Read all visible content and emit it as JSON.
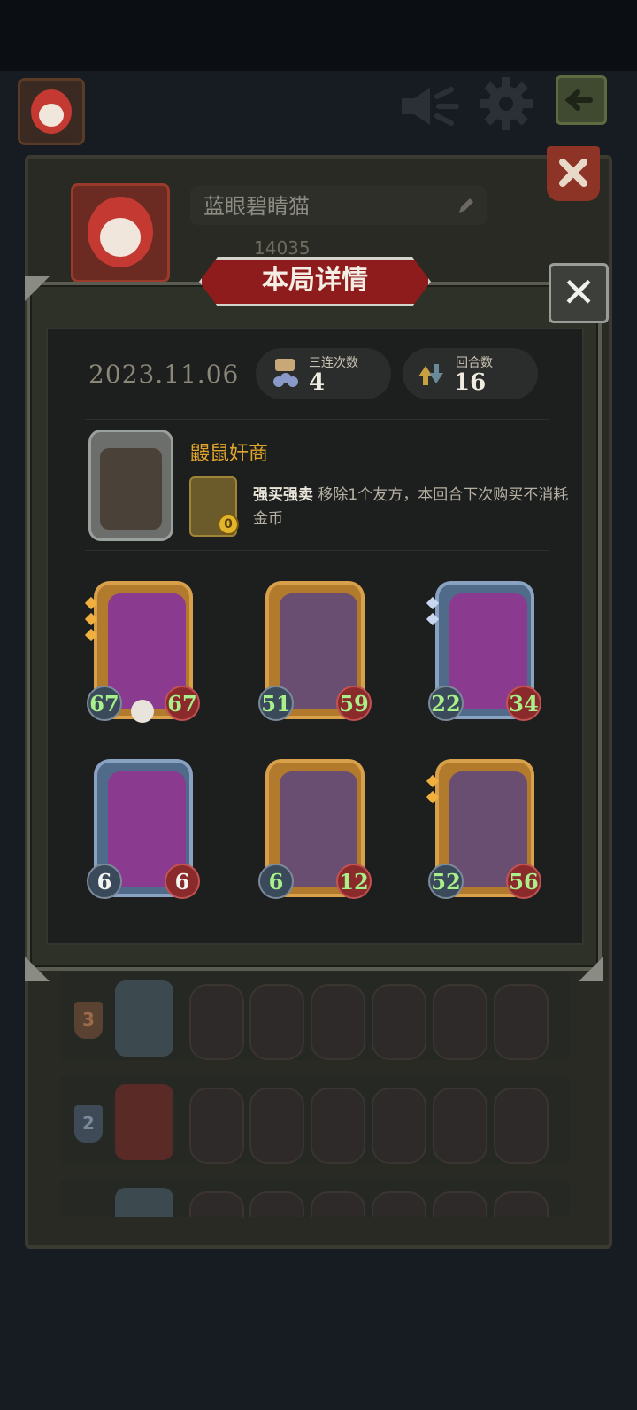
{
  "header": {
    "speaker_icon": "speaker-icon",
    "settings_icon": "gear-icon",
    "exit_icon": "exit-icon"
  },
  "profile": {
    "name": "蓝眼碧睛猫",
    "score": "14035"
  },
  "dialog": {
    "title": "本局详情",
    "close_label": "✕",
    "date": "2023.11.06",
    "triple": {
      "label": "三连次数",
      "value": "4"
    },
    "rounds": {
      "label": "回合数",
      "value": "16"
    },
    "hero": {
      "name": "鼹鼠奸商",
      "skill_name": "强买强卖",
      "skill_desc": "移除1个友方，本回合下次购买不消耗金币",
      "skill_cost": "0"
    },
    "units": [
      {
        "atk": "67",
        "hp": "67",
        "frame": "gold",
        "pips": 3
      },
      {
        "atk": "51",
        "hp": "59",
        "frame": "gold",
        "pips": 0
      },
      {
        "atk": "22",
        "hp": "34",
        "frame": "blue",
        "pips": 2
      },
      {
        "atk": "6",
        "hp": "6",
        "frame": "blue",
        "pips": 0
      },
      {
        "atk": "6",
        "hp": "12",
        "frame": "gold",
        "pips": 0
      },
      {
        "atk": "52",
        "hp": "56",
        "frame": "gold",
        "pips": 2
      }
    ]
  },
  "history": [
    {
      "rank": "3"
    },
    {
      "rank": "2"
    }
  ],
  "colors": {
    "banner": "#8e1c1c",
    "accent_gold": "#e0a52a",
    "stat_green": "#a7f08a"
  }
}
